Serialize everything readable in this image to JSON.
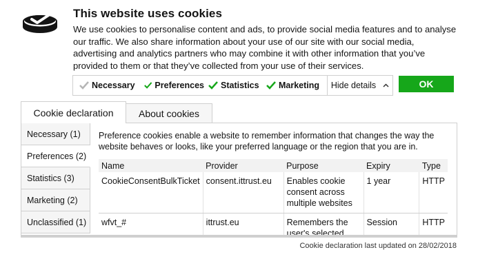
{
  "logo": {
    "icon": "cookie-check-icon"
  },
  "banner": {
    "title": "This website uses cookies",
    "intro": "We use cookies to personalise content and ads, to provide social media features and to analyse our traffic. We also share information about your use of our site with our social media, advertising and analytics partners who may combine it with other information that you’ve provided to them or that they’ve collected from your use of their services."
  },
  "consent": {
    "checkboxes": [
      {
        "label": "Necessary",
        "checked": true,
        "disabled": true
      },
      {
        "label": "Preferences",
        "checked": true
      },
      {
        "label": "Statistics",
        "checked": true
      },
      {
        "label": "Marketing",
        "checked": true
      }
    ],
    "hide_details_label": "Hide details",
    "ok_label": "OK"
  },
  "tabs": [
    {
      "label": "Cookie declaration",
      "active": true
    },
    {
      "label": "About cookies",
      "active": false
    }
  ],
  "categories": [
    {
      "label": "Necessary (1)"
    },
    {
      "label": "Preferences (2)",
      "active": true
    },
    {
      "label": "Statistics (3)"
    },
    {
      "label": "Marketing (2)"
    },
    {
      "label": "Unclassified (1)"
    }
  ],
  "details": {
    "description": "Preference cookies enable a website to remember information that changes the way the website behaves or looks, like your preferred language or the region that you are in.",
    "columns": [
      "Name",
      "Provider",
      "Purpose",
      "Expiry",
      "Type"
    ],
    "rows": [
      [
        "CookieConsentBulkTicket",
        "consent.ittrust.eu",
        "Enables cookie consent across multiple websites",
        "1 year",
        "HTTP"
      ],
      [
        "wfvt_#",
        "ittrust.eu",
        "Remembers the user's selected",
        "Session",
        "HTTP"
      ]
    ]
  },
  "footer": {
    "updated": "Cookie declaration last updated on 28/02/2018"
  },
  "colors": {
    "accent": "#16a71a",
    "border": "#cfcfcf"
  }
}
